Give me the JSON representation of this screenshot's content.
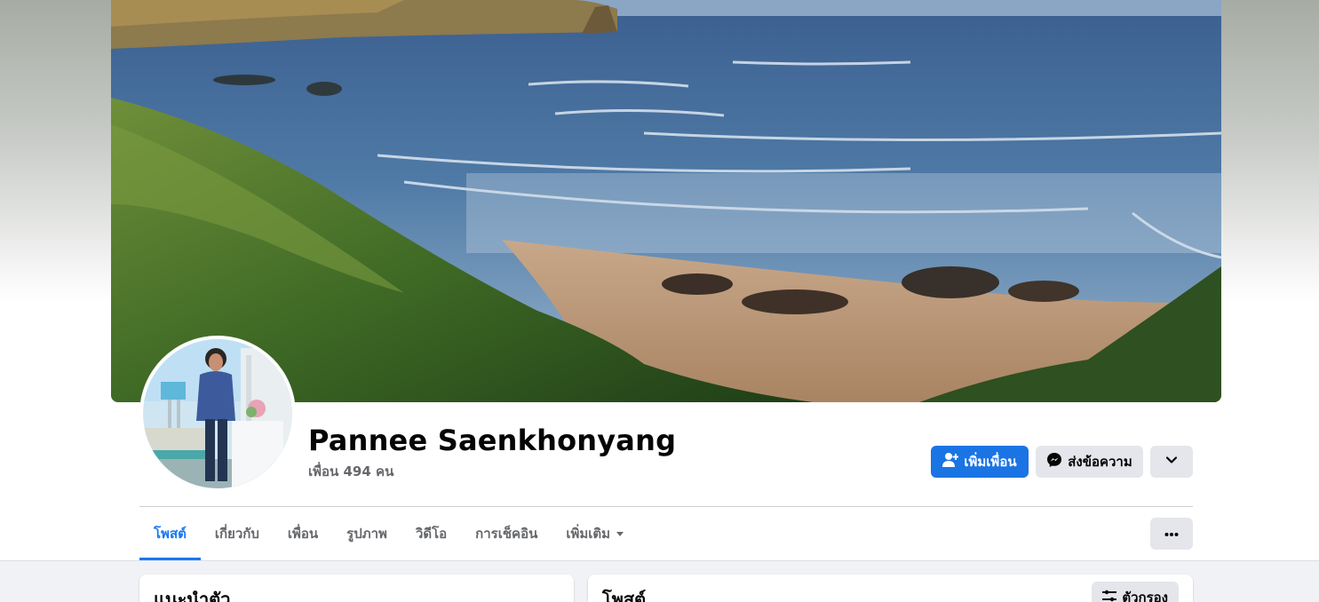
{
  "profile": {
    "name": "Pannee Saenkhonyang",
    "friends_text": "เพื่อน 494 คน"
  },
  "actions": {
    "add_friend_label": "เพิ่มเพื่อน",
    "message_label": "ส่งข้อความ"
  },
  "tabs": [
    {
      "label": "โพสต์",
      "active": true
    },
    {
      "label": "เกี่ยวกับ",
      "active": false
    },
    {
      "label": "เพื่อน",
      "active": false
    },
    {
      "label": "รูปภาพ",
      "active": false
    },
    {
      "label": "วิดีโอ",
      "active": false
    },
    {
      "label": "การเช็คอิน",
      "active": false
    },
    {
      "label": "เพิ่มเติม",
      "active": false
    }
  ],
  "cards": {
    "intro_title": "แนะนำตัว",
    "posts_title": "โพสต์",
    "filter_label": "ตัวกรอง"
  },
  "icons": {
    "add_friend": "person-add-icon",
    "messenger": "messenger-icon",
    "chevron": "chevron-down-icon",
    "more": "ellipsis-icon",
    "filter": "filter-sliders-icon",
    "tab_caret": "caret-down-icon"
  },
  "colors": {
    "accent": "#1877f2",
    "primary_button": "#1b74e4",
    "secondary_button": "#e4e6eb",
    "muted_text": "#65676b",
    "page_background": "#f0f2f5"
  }
}
